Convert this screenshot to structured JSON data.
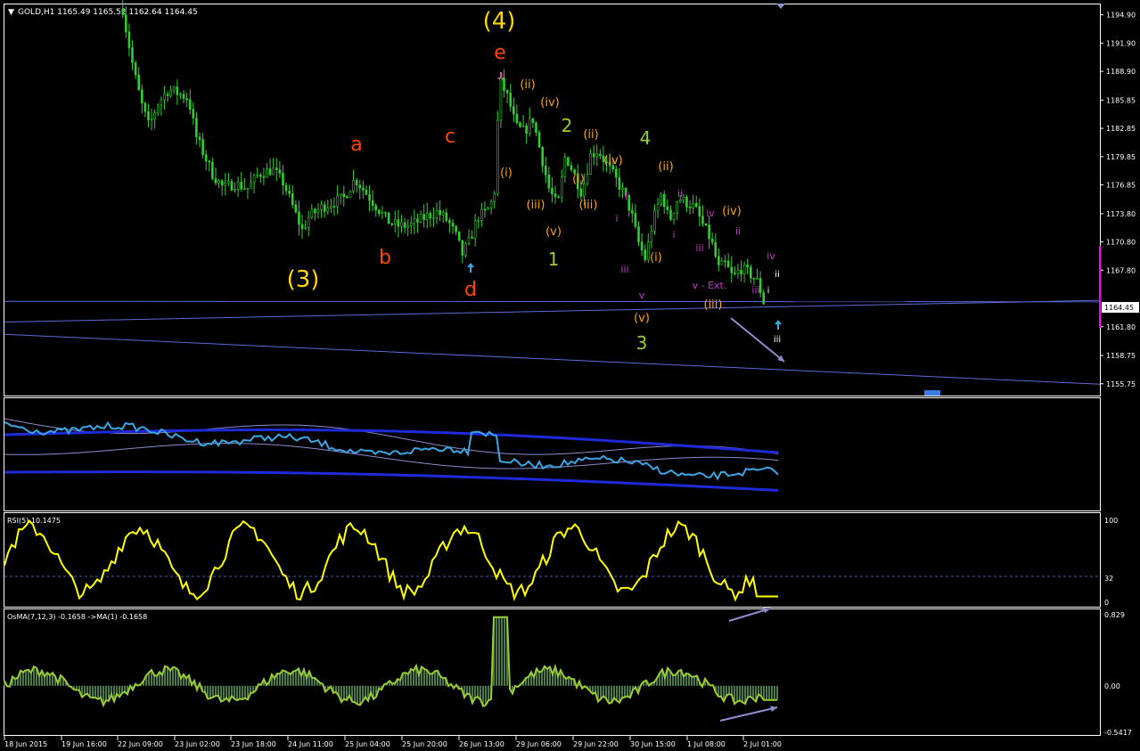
{
  "header": {
    "menu_glyph": "▼",
    "symbol_info": "GOLD,H1  1165.49 1165.52 1162.64 1164.45"
  },
  "panes": {
    "rsi_label": "RSI(5) 10.1475",
    "osma_label": "OsMA(7,12,3) -0.1658  ->MA(1) -0.1658"
  },
  "colors": {
    "background": "#000000",
    "candles": "#32CD32",
    "grid_border": "#FFFFFF",
    "channel_lines": "#5B6BD9",
    "arrow_lines": "#8E8ECF",
    "rsi_line": "#FFFF00",
    "osma_line": "#9ACD32",
    "osma_hist": "#4A7A4A",
    "bands_mid": "#3BA7E6",
    "bands_outer": "#1E2ADA",
    "bands_inner": "#8A8AD0",
    "label_yellow": "#FFD700",
    "label_red": "#FF4500",
    "label_orange": "#FFA500",
    "label_green": "#9ACD32",
    "label_magenta": "#CC33CC",
    "price_marker": "#FF00FF"
  },
  "chart_data": {
    "type": "candlestick",
    "symbol": "GOLD",
    "timeframe": "H1",
    "price_axis": {
      "range": [
        1154.5,
        1196.0
      ],
      "ticks": [
        "1194.90",
        "1191.90",
        "1188.90",
        "1185.85",
        "1182.85",
        "1179.85",
        "1176.85",
        "1173.80",
        "1170.80",
        "1167.80",
        "1164.45",
        "1161.80",
        "1158.75",
        "1155.75"
      ],
      "current_price": "1164.45"
    },
    "time_axis": {
      "labels": [
        "18 Jun 2015",
        "19 Jun 16:00",
        "22 Jun 09:00",
        "23 Jun 02:00",
        "23 Jun 18:00",
        "24 Jun 11:00",
        "25 Jun 04:00",
        "25 Jun 20:00",
        "26 Jun 13:00",
        "29 Jun 06:00",
        "29 Jun 22:00",
        "30 Jun 15:00",
        "1 Jul 08:00",
        "2 Jul 01:00"
      ]
    },
    "price_path": [
      [
        0.108,
        1195.5
      ],
      [
        0.11,
        1194.0
      ],
      [
        0.118,
        1189.0
      ],
      [
        0.125,
        1185.5
      ],
      [
        0.132,
        1183.0
      ],
      [
        0.14,
        1185.5
      ],
      [
        0.15,
        1187.0
      ],
      [
        0.16,
        1186.5
      ],
      [
        0.168,
        1186.0
      ],
      [
        0.175,
        1182.0
      ],
      [
        0.19,
        1178.0
      ],
      [
        0.2,
        1176.5
      ],
      [
        0.21,
        1177.0
      ],
      [
        0.222,
        1176.5
      ],
      [
        0.232,
        1178.0
      ],
      [
        0.245,
        1178.5
      ],
      [
        0.255,
        1177.0
      ],
      [
        0.265,
        1174.0
      ],
      [
        0.272,
        1172.0
      ],
      [
        0.278,
        1173.5
      ],
      [
        0.29,
        1174.5
      ],
      [
        0.3,
        1175.0
      ],
      [
        0.31,
        1175.5
      ],
      [
        0.32,
        1177.5
      ],
      [
        0.33,
        1176.0
      ],
      [
        0.34,
        1174.5
      ],
      [
        0.35,
        1173.0
      ],
      [
        0.36,
        1172.5
      ],
      [
        0.37,
        1172.5
      ],
      [
        0.385,
        1173.5
      ],
      [
        0.395,
        1174.0
      ],
      [
        0.405,
        1173.0
      ],
      [
        0.412,
        1171.5
      ],
      [
        0.418,
        1169.5
      ],
      [
        0.425,
        1171.0
      ],
      [
        0.432,
        1173.5
      ],
      [
        0.44,
        1174.0
      ],
      [
        0.447,
        1175.5
      ],
      [
        0.452,
        1188.0
      ],
      [
        0.46,
        1186.0
      ],
      [
        0.467,
        1183.0
      ],
      [
        0.475,
        1182.5
      ],
      [
        0.482,
        1184.0
      ],
      [
        0.49,
        1180.0
      ],
      [
        0.497,
        1176.5
      ],
      [
        0.505,
        1174.5
      ],
      [
        0.512,
        1180.0
      ],
      [
        0.52,
        1178.0
      ],
      [
        0.527,
        1176.0
      ],
      [
        0.535,
        1180.0
      ],
      [
        0.542,
        1180.5
      ],
      [
        0.55,
        1179.0
      ],
      [
        0.558,
        1177.5
      ],
      [
        0.565,
        1176.0
      ],
      [
        0.572,
        1174.0
      ],
      [
        0.578,
        1171.0
      ],
      [
        0.585,
        1169.0
      ],
      [
        0.592,
        1173.0
      ],
      [
        0.6,
        1176.0
      ],
      [
        0.607,
        1173.0
      ],
      [
        0.615,
        1175.5
      ],
      [
        0.622,
        1175.0
      ],
      [
        0.63,
        1174.5
      ],
      [
        0.638,
        1172.5
      ],
      [
        0.645,
        1171.0
      ],
      [
        0.652,
        1168.0
      ],
      [
        0.658,
        1168.5
      ],
      [
        0.665,
        1167.0
      ],
      [
        0.672,
        1168.0
      ],
      [
        0.68,
        1167.5
      ],
      [
        0.688,
        1166.5
      ],
      [
        0.693,
        1164.45
      ]
    ],
    "indicators": {
      "rsi": {
        "period": 5,
        "value": 10.1475,
        "scale": [
          0,
          100
        ],
        "level": 32
      },
      "osma": {
        "fast": 7,
        "slow": 12,
        "signal": 3,
        "value": -0.1658,
        "ma_period": 1,
        "scale_labels": [
          "0.829",
          "0.00",
          "-0.5417"
        ]
      },
      "bands_pane": {
        "series": [
          "outer upper",
          "outer lower",
          "inner bands",
          "main oscillator"
        ]
      }
    },
    "annotations": [
      {
        "text": "(4)",
        "color": "label_yellow"
      },
      {
        "text": "(3)",
        "color": "label_yellow"
      },
      {
        "text": "e",
        "color": "label_red"
      },
      {
        "text": "a",
        "color": "label_red"
      },
      {
        "text": "b",
        "color": "label_red"
      },
      {
        "text": "c",
        "color": "label_red"
      },
      {
        "text": "d",
        "color": "label_red"
      },
      {
        "text": "2",
        "color": "label_green"
      },
      {
        "text": "1",
        "color": "label_green"
      },
      {
        "text": "4",
        "color": "label_green"
      },
      {
        "text": "3",
        "color": "label_green"
      },
      {
        "text": "(ii)",
        "color": "label_orange"
      },
      {
        "text": "(iv)",
        "color": "label_orange"
      },
      {
        "text": "(i)",
        "color": "label_orange"
      },
      {
        "text": "(iii)",
        "color": "label_orange"
      },
      {
        "text": "(v)",
        "color": "label_orange"
      },
      {
        "text": "(ii)",
        "color": "label_orange"
      },
      {
        "text": "(i)",
        "color": "label_orange"
      },
      {
        "text": "(iii)",
        "color": "label_orange"
      },
      {
        "text": "(iv)",
        "color": "label_orange"
      },
      {
        "text": "(ii)",
        "color": "label_orange"
      },
      {
        "text": "(i)",
        "color": "label_orange"
      },
      {
        "text": "(v)",
        "color": "label_orange"
      },
      {
        "text": "(iv)",
        "color": "label_orange"
      },
      {
        "text": "(iii)",
        "color": "label_orange"
      },
      {
        "text": "ii",
        "color": "label_magenta"
      },
      {
        "text": "i",
        "color": "label_magenta"
      },
      {
        "text": "iii",
        "color": "label_magenta"
      },
      {
        "text": "v",
        "color": "label_magenta"
      },
      {
        "text": "ii",
        "color": "label_magenta"
      },
      {
        "text": "i",
        "color": "label_magenta"
      },
      {
        "text": "iv",
        "color": "label_magenta"
      },
      {
        "text": "ii",
        "color": "label_magenta"
      },
      {
        "text": "iii",
        "color": "label_magenta"
      },
      {
        "text": "v - Ext.",
        "color": "label_magenta"
      },
      {
        "text": "iii",
        "color": "label_magenta"
      },
      {
        "text": "iv",
        "color": "label_magenta"
      },
      {
        "text": "ii",
        "color": "#FFFFFF"
      },
      {
        "text": "i",
        "color": "#FFFFFF"
      },
      {
        "text": "iii",
        "color": "#FFFFFF"
      }
    ]
  }
}
